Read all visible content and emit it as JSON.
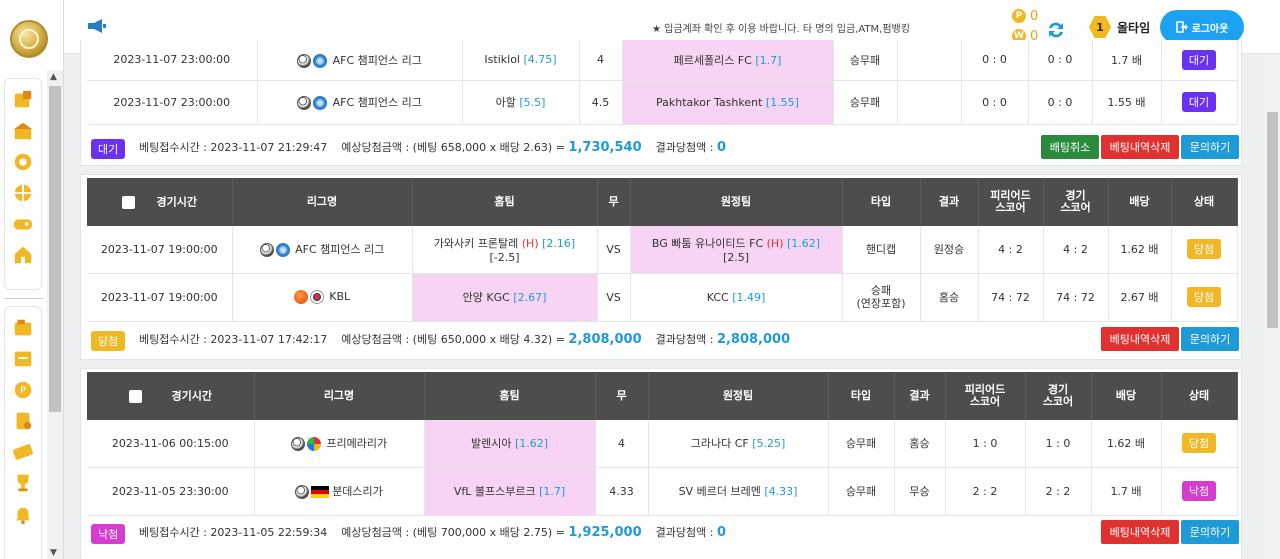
{
  "header": {
    "notice": "★ 입금계좌 확인 후 이용 바랍니다. 타 명의 입금,ATM,펌뱅킹",
    "point_icon": "P",
    "point_value": "0",
    "won_icon": "W",
    "won_value": "0",
    "level_number": "1",
    "level_name": "올타임",
    "logout_label": "로그아웃"
  },
  "columns": {
    "time": "경기시간",
    "league": "리그명",
    "home": "홈팀",
    "draw": "무",
    "away": "원정팀",
    "type": "타입",
    "result": "결과",
    "period_score": "피리어드\n스코어",
    "game_score": "경기\n스코어",
    "odds": "배당",
    "status": "상태"
  },
  "card1": {
    "rows": [
      {
        "time": "2023-11-07 23:00:00",
        "league": "AFC 챔피언스 리그",
        "home": "Istiklol",
        "home_odds": "[4.75]",
        "draw": "4",
        "away": "페르세폴리스 FC",
        "away_odds": "[1.7]",
        "type": "승무패",
        "result": "",
        "period": "0 : 0",
        "score": "0 : 0",
        "odds": "1.7 배",
        "status": "대기"
      },
      {
        "time": "2023-11-07 23:00:00",
        "league": "AFC 챔피언스 리그",
        "home": "아할",
        "home_odds": "[5.5]",
        "draw": "4.5",
        "away": "Pakhtakor Tashkent",
        "away_odds": "[1.55]",
        "type": "승무패",
        "result": "",
        "period": "0 : 0",
        "score": "0 : 0",
        "odds": "1.55 배",
        "status": "대기"
      }
    ],
    "footer": {
      "status": "대기",
      "bet_time_label": "베팅접수시간 : ",
      "bet_time": "2023-11-07 21:29:47",
      "expected_label": "예상당첨금액 : (베팅 658,000 x 배당 2.63) = ",
      "expected": "1,730,540",
      "result_label": "결과당첨액 : ",
      "result": "0",
      "btn_cancel": "배팅취소",
      "btn_delete": "베팅내역삭제",
      "btn_ask": "문의하기"
    }
  },
  "card2": {
    "rows": [
      {
        "time": "2023-11-07 19:00:00",
        "league": "AFC 챔피언스 리그",
        "home": "가와사키 프론탈레",
        "home_mark": "(H)",
        "home_odds": "[2.16]",
        "home_handicap": "[-2.5]",
        "draw": "VS",
        "away": "BG 빠툼 유나이티드 FC",
        "away_mark": "(H)",
        "away_odds": "[1.62]",
        "away_handicap": "[2.5]",
        "type": "핸디캡",
        "result": "원정승",
        "period": "4 : 2",
        "score": "4 : 2",
        "odds": "1.62 배",
        "status": "당첨"
      },
      {
        "time": "2023-11-07 19:00:00",
        "league": "KBL",
        "home": "안양 KGC",
        "home_odds": "[2.67]",
        "draw": "VS",
        "away": "KCC",
        "away_odds": "[1.49]",
        "type": "승패\n(연장포함)",
        "result": "홈승",
        "period": "74 : 72",
        "score": "74 : 72",
        "odds": "2.67 배",
        "status": "당첨"
      }
    ],
    "footer": {
      "status": "당첨",
      "bet_time_label": "베팅접수시간 : ",
      "bet_time": "2023-11-07 17:42:17",
      "expected_label": "예상당첨금액 : (베팅 650,000 x 배당 4.32) = ",
      "expected": "2,808,000",
      "result_label": "결과당첨액 : ",
      "result": "2,808,000",
      "btn_delete": "베팅내역삭제",
      "btn_ask": "문의하기"
    }
  },
  "card3": {
    "rows": [
      {
        "time": "2023-11-06 00:15:00",
        "league": "프리메라리가",
        "home": "발렌시아",
        "home_odds": "[1.62]",
        "draw": "4",
        "away": "그라나다 CF",
        "away_odds": "[5.25]",
        "type": "승무패",
        "result": "홈승",
        "period": "1 : 0",
        "score": "1 : 0",
        "odds": "1.62 배",
        "status": "당첨"
      },
      {
        "time": "2023-11-05 23:30:00",
        "league": "분데스리가",
        "home": "VfL 볼프스부르크",
        "home_odds": "[1.7]",
        "draw": "4.33",
        "away": "SV 베르더 브레멘",
        "away_odds": "[4.33]",
        "type": "승무패",
        "result": "무승",
        "period": "2 : 2",
        "score": "2 : 2",
        "odds": "1.7 배",
        "status": "낙첨"
      }
    ],
    "footer": {
      "status": "낙첨",
      "bet_time_label": "베팅접수시간 : ",
      "bet_time": "2023-11-05 22:59:34",
      "expected_label": "예상당첨금액 : (베팅 700,000 x 배당 2.75) = ",
      "expected": "1,925,000",
      "result_label": "결과당첨액 : ",
      "result": "0",
      "btn_delete": "베팅내역삭제",
      "btn_ask": "문의하기"
    }
  }
}
